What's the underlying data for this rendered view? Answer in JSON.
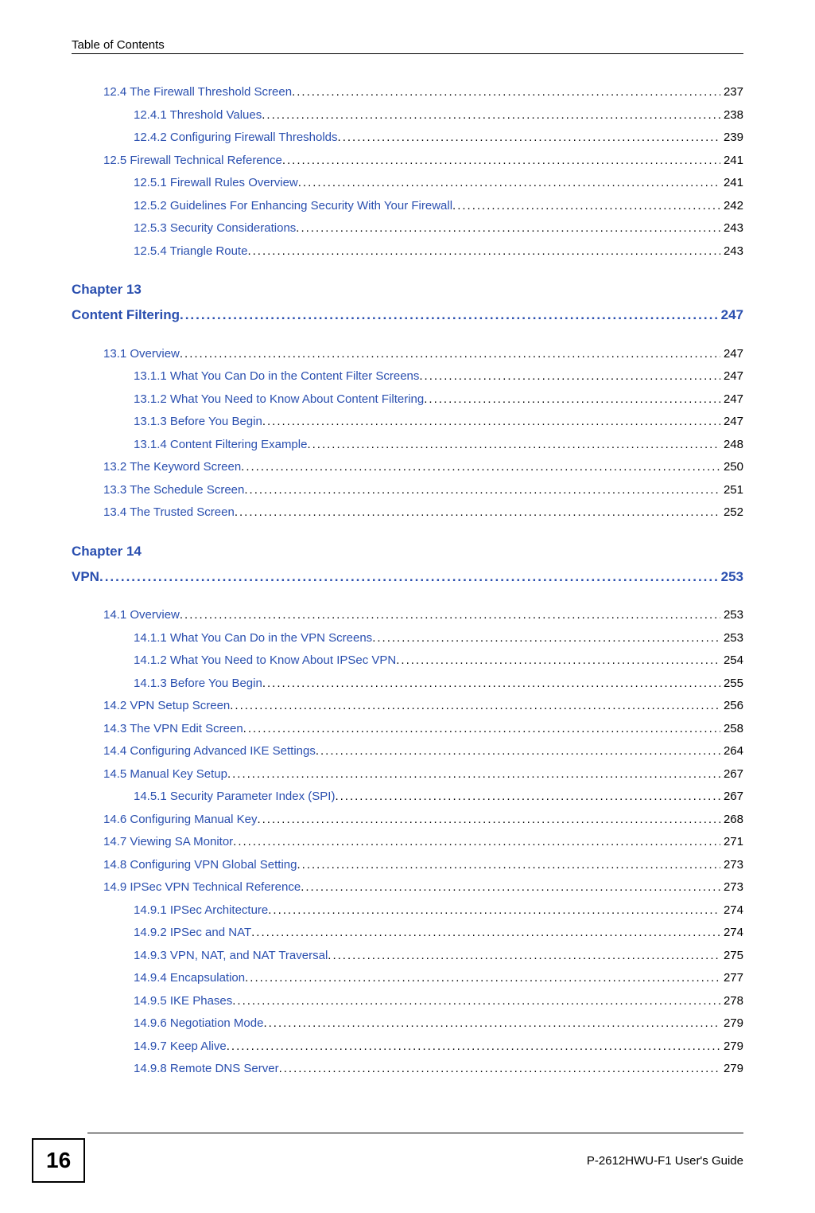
{
  "header": {
    "title": "Table of Contents"
  },
  "footer": {
    "page_number": "16",
    "guide": "P-2612HWU-F1 User's Guide"
  },
  "toc": {
    "group1": [
      {
        "level": 1,
        "label": "12.4 The Firewall Threshold Screen",
        "page": "237"
      },
      {
        "level": 2,
        "label": "12.4.1 Threshold Values",
        "page": "238"
      },
      {
        "level": 2,
        "label": "12.4.2 Configuring Firewall Thresholds",
        "page": "239"
      },
      {
        "level": 1,
        "label": "12.5 Firewall Technical Reference",
        "page": "241"
      },
      {
        "level": 2,
        "label": "12.5.1 Firewall Rules Overview",
        "page": "241"
      },
      {
        "level": 2,
        "label": "12.5.2 Guidelines For Enhancing Security With Your Firewall",
        "page": "242"
      },
      {
        "level": 2,
        "label": "12.5.3 Security Considerations",
        "page": "243"
      },
      {
        "level": 2,
        "label": "12.5.4 Triangle Route",
        "page": "243"
      }
    ],
    "chapter13": {
      "line1": "Chapter  13",
      "title": "Content Filtering",
      "page": "247"
    },
    "group2": [
      {
        "level": 1,
        "label": "13.1 Overview",
        "page": "247"
      },
      {
        "level": 2,
        "label": "13.1.1 What You Can Do in the Content Filter Screens",
        "page": "247"
      },
      {
        "level": 2,
        "label": "13.1.2 What You Need to Know About Content Filtering",
        "page": "247"
      },
      {
        "level": 2,
        "label": "13.1.3 Before You Begin",
        "page": "247"
      },
      {
        "level": 2,
        "label": "13.1.4 Content Filtering Example",
        "page": "248"
      },
      {
        "level": 1,
        "label": "13.2 The Keyword Screen",
        "page": "250"
      },
      {
        "level": 1,
        "label": "13.3 The Schedule Screen",
        "page": "251"
      },
      {
        "level": 1,
        "label": "13.4 The Trusted Screen",
        "page": "252"
      }
    ],
    "chapter14": {
      "line1": "Chapter  14",
      "title": "VPN",
      "page": "253"
    },
    "group3": [
      {
        "level": 1,
        "label": "14.1 Overview",
        "page": "253"
      },
      {
        "level": 2,
        "label": "14.1.1 What You Can Do in the VPN Screens",
        "page": "253"
      },
      {
        "level": 2,
        "label": "14.1.2 What You Need to Know About IPSec VPN",
        "page": "254"
      },
      {
        "level": 2,
        "label": "14.1.3 Before You Begin",
        "page": "255"
      },
      {
        "level": 1,
        "label": "14.2 VPN Setup Screen",
        "page": "256"
      },
      {
        "level": 1,
        "label": "14.3 The VPN Edit Screen",
        "page": "258"
      },
      {
        "level": 1,
        "label": "14.4 Configuring Advanced IKE Settings",
        "page": "264"
      },
      {
        "level": 1,
        "label": "14.5 Manual Key Setup",
        "page": "267"
      },
      {
        "level": 2,
        "label": "14.5.1 Security Parameter Index (SPI)",
        "page": "267"
      },
      {
        "level": 1,
        "label": "14.6 Configuring Manual Key",
        "page": "268"
      },
      {
        "level": 1,
        "label": "14.7 Viewing SA Monitor",
        "page": "271"
      },
      {
        "level": 1,
        "label": "14.8 Configuring VPN Global Setting",
        "page": "273"
      },
      {
        "level": 1,
        "label": "14.9 IPSec VPN Technical Reference",
        "page": "273"
      },
      {
        "level": 2,
        "label": "14.9.1 IPSec Architecture",
        "page": "274"
      },
      {
        "level": 2,
        "label": "14.9.2 IPSec and NAT",
        "page": "274"
      },
      {
        "level": 2,
        "label": "14.9.3 VPN, NAT, and NAT Traversal",
        "page": "275"
      },
      {
        "level": 2,
        "label": "14.9.4 Encapsulation",
        "page": "277"
      },
      {
        "level": 2,
        "label": "14.9.5  IKE Phases",
        "page": "278"
      },
      {
        "level": 2,
        "label": "14.9.6 Negotiation Mode",
        "page": "279"
      },
      {
        "level": 2,
        "label": "14.9.7 Keep Alive",
        "page": "279"
      },
      {
        "level": 2,
        "label": "14.9.8 Remote DNS Server",
        "page": "279"
      }
    ]
  }
}
